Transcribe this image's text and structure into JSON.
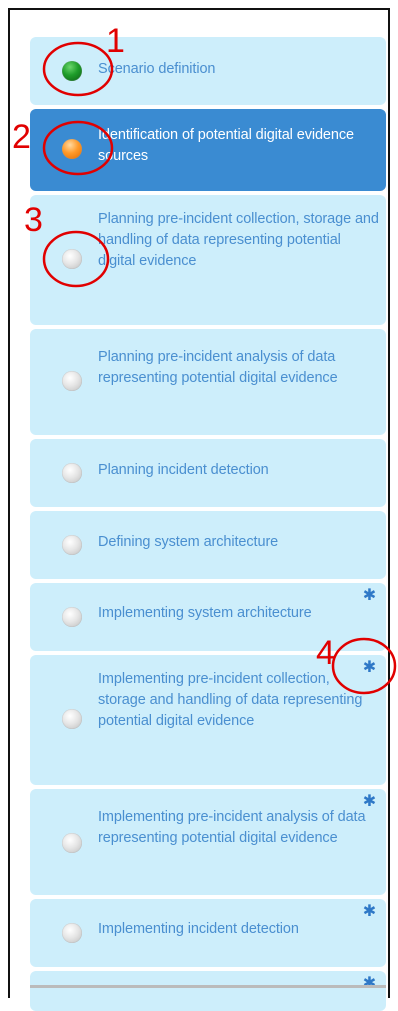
{
  "steps": [
    {
      "label": "Scenario definition",
      "state": "green",
      "active": false,
      "star": false
    },
    {
      "label": "Identification of potential digital evidence sources",
      "state": "orange",
      "active": true,
      "star": false
    },
    {
      "label": "Planning pre-incident collection, storage and handling of data representing potential digital evidence",
      "state": "grey",
      "active": false,
      "star": false
    },
    {
      "label": "Planning pre-incident analysis of data representing potential digital evidence",
      "state": "grey",
      "active": false,
      "star": false
    },
    {
      "label": "Planning incident detection",
      "state": "grey",
      "active": false,
      "star": false
    },
    {
      "label": "Defining system architecture",
      "state": "grey",
      "active": false,
      "star": false
    },
    {
      "label": "Implementing system architecture",
      "state": "grey",
      "active": false,
      "star": true
    },
    {
      "label": "Implementing pre-incident collection, storage and handling of data representing potential digital evidence",
      "state": "grey",
      "active": false,
      "star": true
    },
    {
      "label": "Implementing pre-incident analysis of data representing potential digital evidence",
      "state": "grey",
      "active": false,
      "star": true
    },
    {
      "label": "Implementing incident detection",
      "state": "grey",
      "active": false,
      "star": true
    },
    {
      "label": "",
      "state": "none",
      "active": false,
      "star": true
    }
  ],
  "star_glyph": "✱",
  "annotations": [
    "1",
    "2",
    "3",
    "4"
  ],
  "colors": {
    "item_bg": "#cdeefb",
    "item_text": "#4a8fd0",
    "active_bg": "#3a8bd2",
    "active_text": "#ffffff",
    "annotation": "#e10000"
  }
}
